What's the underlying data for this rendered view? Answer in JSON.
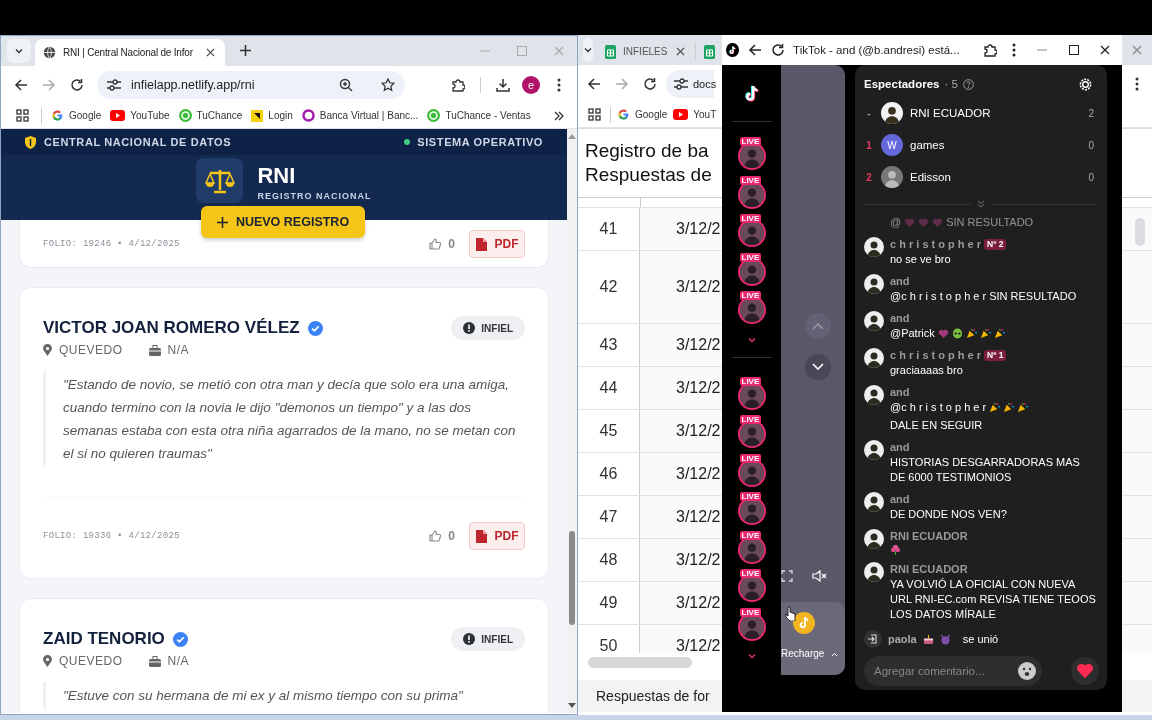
{
  "left_browser": {
    "tab": {
      "title": "RNI | Central Nacional de Infor",
      "selected": true
    },
    "url": "infielapp.netlify.app/rni",
    "profile": "e",
    "bookmarks": [
      {
        "kind": "google",
        "label": "Google"
      },
      {
        "kind": "youtube",
        "label": "YouTube"
      },
      {
        "kind": "tuchance",
        "label": "TuChance"
      },
      {
        "kind": "login",
        "label": "Login"
      },
      {
        "kind": "bank",
        "label": "Banca Virtual | Banc..."
      },
      {
        "kind": "tuchance",
        "label": "TuChance - Ventas"
      }
    ]
  },
  "rni": {
    "top_label": "CENTRAL NACIONAL DE DATOS",
    "status": "SISTEMA OPERATIVO",
    "brand": "RNI",
    "brand_subtitle": "REGISTRO NACIONAL",
    "new_button": "NUEVO REGISTRO",
    "cards": [
      {
        "kind": "footer",
        "folio": "FOLIO: 19246 • 4/12/2025",
        "likes": "0",
        "pdf": "PDF"
      },
      {
        "kind": "full",
        "name": "VICTOR JOAN ROMERO VÉLEZ",
        "verified": true,
        "tag": "INFIEL",
        "city": "QUEVEDO",
        "job": "N/A",
        "quote": "\"Estando de novio, se metió con otra man y decía que solo era una amiga, cuando termino con la novia le dijo \"demonos un tiempo\" y a las dos semanas estaba con esta otra niña agarrados de la mano, no se metan con el si no quieren traumas\"",
        "folio": "FOLIO: 19336 • 4/12/2025",
        "likes": "0",
        "pdf": "PDF"
      },
      {
        "kind": "head",
        "name": "ZAID TENORIO",
        "verified": true,
        "tag": "INFIEL",
        "city": "QUEVEDO",
        "job": "N/A",
        "quote": "\"Estuve con su hermana de mi ex y al mismo tiempo con su prima\""
      }
    ]
  },
  "sheet_browser": {
    "tabs": [
      {
        "kind": "sheets",
        "label": "INFIELES"
      },
      {
        "kind": "sheets"
      }
    ],
    "url": "docs",
    "bookmarks": [
      {
        "kind": "google",
        "label": "Google"
      },
      {
        "kind": "youtube",
        "label": "YouT"
      }
    ]
  },
  "sheet": {
    "title": [
      "Registro de ba",
      "Respuestas de"
    ],
    "rows": [
      {
        "number": "41",
        "date": "3/12/2"
      },
      {
        "number": "42",
        "date": "3/12/2"
      },
      {
        "number": "43",
        "date": "3/12/2"
      },
      {
        "number": "44",
        "date": "3/12/2"
      },
      {
        "number": "45",
        "date": "3/12/2"
      },
      {
        "number": "46",
        "date": "3/12/2"
      },
      {
        "number": "47",
        "date": "3/12/2"
      },
      {
        "number": "48",
        "date": "3/12/2"
      },
      {
        "number": "49",
        "date": "3/12/2"
      },
      {
        "number": "50",
        "date": "3/12/2"
      }
    ],
    "sheet_tab": "Respuestas de for"
  },
  "tiktok": {
    "title": "TikTok - and (@b.andresi) está...",
    "rail": [
      {
        "badge": "LIVE"
      },
      {
        "badge": "LIVE"
      },
      {
        "badge": "LIVE"
      },
      {
        "badge": "LIVE"
      },
      {
        "badge": "LIVE"
      }
    ],
    "rail_more": [
      {
        "badge": "LIVE"
      },
      {
        "badge": "LIVE"
      },
      {
        "badge": "LIVE"
      },
      {
        "badge": "LIVE"
      },
      {
        "badge": "LIVE"
      },
      {
        "badge": "LIVE"
      },
      {
        "badge": "LIVE"
      }
    ],
    "recharge": "Recharge",
    "viewers_title": "Espectadores",
    "viewers_count": "· 5",
    "viewers": [
      {
        "rank": "-",
        "ranked": false,
        "name": "RNI ECUADOR",
        "score": "2"
      },
      {
        "rank": "1",
        "ranked": true,
        "initial": "W",
        "name": "games",
        "score": "0"
      },
      {
        "rank": "2",
        "ranked": true,
        "name": "Edisson",
        "score": "0"
      }
    ],
    "messages": [
      {
        "kind": "faded",
        "parts": [
          {
            "kind": "text",
            "text": "@"
          },
          {
            "kind": "heart"
          },
          {
            "kind": "heart"
          },
          {
            "kind": "heart"
          },
          {
            "kind": "text",
            "text": "SIN RESULTADO"
          }
        ]
      },
      {
        "kind": "chat",
        "user": "c h r i s t o p h e r",
        "badge": "Nº 2",
        "parts": [
          {
            "kind": "text",
            "text": "no se ve bro"
          }
        ]
      },
      {
        "kind": "chat",
        "user": "and",
        "parts": [
          {
            "kind": "text",
            "text": "@c h r i s t o p h e r SIN RESULTADO"
          }
        ]
      },
      {
        "kind": "chat",
        "user": "and",
        "parts": [
          {
            "kind": "text",
            "text": "@Patrick"
          },
          {
            "kind": "heart"
          },
          {
            "kind": "alien"
          },
          {
            "kind": "party"
          },
          {
            "kind": "party"
          },
          {
            "kind": "party"
          }
        ]
      },
      {
        "kind": "chat",
        "user": "c h r i s t o p h e r",
        "badge": "Nº 1",
        "parts": [
          {
            "kind": "text",
            "text": "graciaaaas bro"
          }
        ]
      },
      {
        "kind": "chat",
        "user": "and",
        "parts": [
          {
            "kind": "text",
            "text": "@c h r i s t o p h e r"
          },
          {
            "kind": "party"
          },
          {
            "kind": "party"
          },
          {
            "kind": "party"
          },
          {
            "kind": "text",
            "text": "DALE EN SEGUIR"
          }
        ]
      },
      {
        "kind": "chat",
        "user": "and",
        "parts": [
          {
            "kind": "text",
            "text": "HISTORIAS DESGARRADORAS MAS DE 6000 TESTIMONIOS"
          }
        ]
      },
      {
        "kind": "chat",
        "user": "and",
        "parts": [
          {
            "kind": "text",
            "text": "DE DONDE NOS VEN?"
          }
        ]
      },
      {
        "kind": "chat",
        "user": "RNI ECUADOR",
        "parts": [
          {
            "kind": "blossom"
          }
        ]
      },
      {
        "kind": "chat",
        "user": "RNI ECUADOR",
        "parts": [
          {
            "kind": "text",
            "text": "YA VOLVIÓ LA OFICIAL CON NUEVA URL RNI-EC.com REVISA TIENE TEOOS LOS DATOS MÍRALE"
          }
        ]
      }
    ],
    "join": {
      "user": "paola",
      "parts": [
        {
          "kind": "cake"
        },
        {
          "kind": "devil"
        }
      ],
      "text": "se unió"
    },
    "comment_placeholder": "Agregar comentario..."
  }
}
